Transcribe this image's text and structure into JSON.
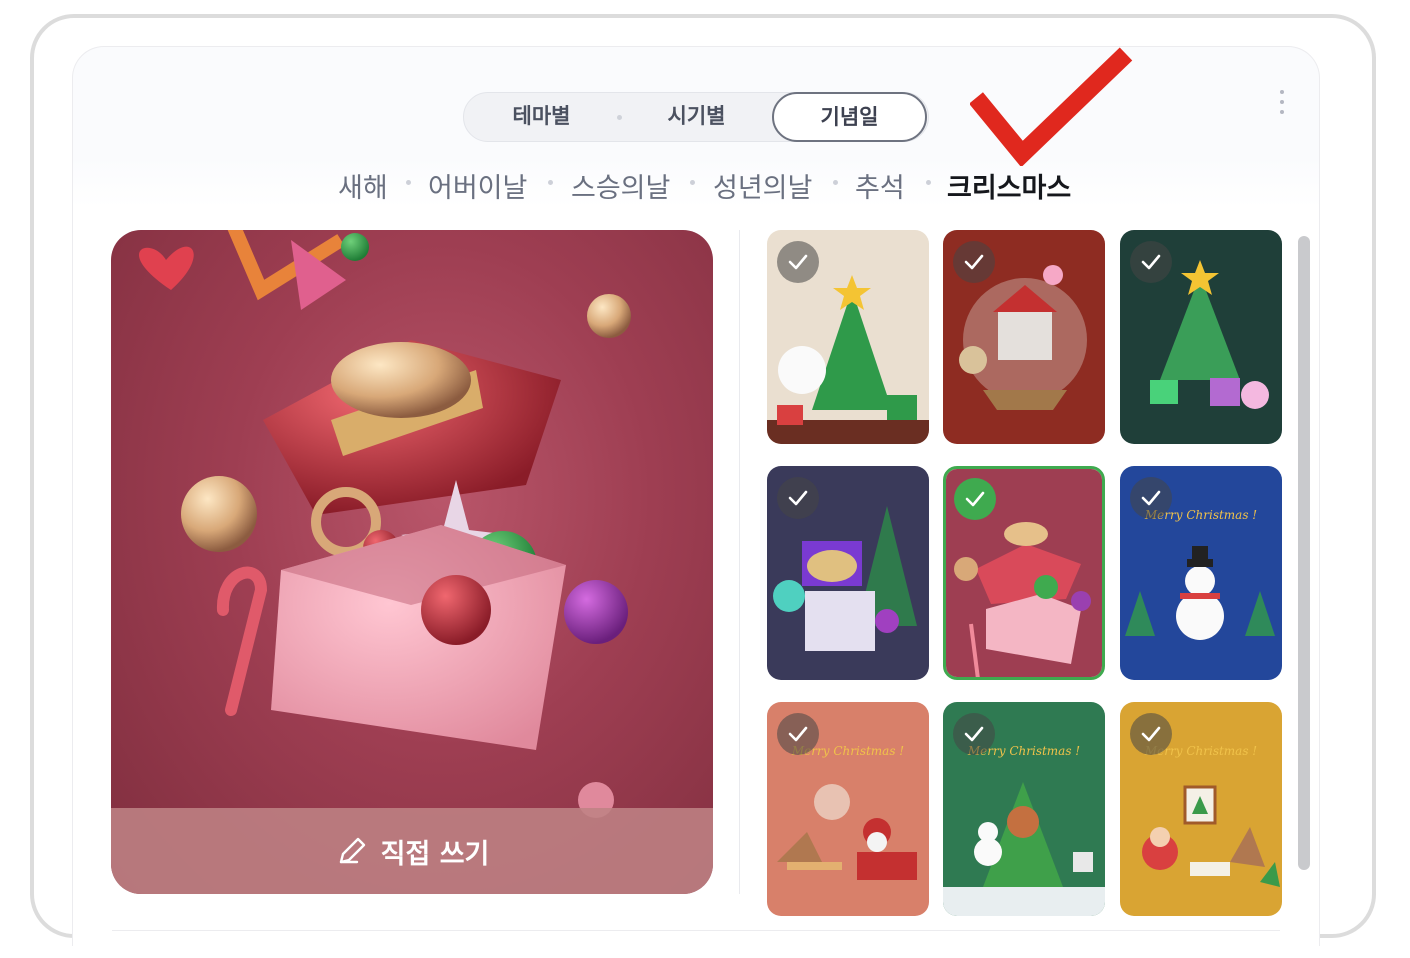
{
  "tabs": {
    "items": [
      {
        "label": "테마별"
      },
      {
        "label": "시기별"
      },
      {
        "label": "기념일"
      }
    ],
    "active": "기념일"
  },
  "categories": {
    "items": [
      {
        "label": "새해"
      },
      {
        "label": "어버이날"
      },
      {
        "label": "스승의날"
      },
      {
        "label": "성년의날"
      },
      {
        "label": "추석"
      },
      {
        "label": "크리스마스"
      }
    ],
    "active": "크리스마스"
  },
  "preview": {
    "write_label": "직접 쓰기"
  },
  "thumbnails": {
    "items": [
      {
        "caption": ""
      },
      {
        "caption": ""
      },
      {
        "caption": ""
      },
      {
        "caption": ""
      },
      {
        "caption": ""
      },
      {
        "caption": "Merry Christmas !"
      },
      {
        "caption": "Merry Christmas !"
      },
      {
        "caption": "Merry Christmas !"
      },
      {
        "caption": "Merry Christmas !"
      }
    ],
    "selected_index": 4
  },
  "colors": {
    "accent_green": "#3faa4f",
    "annotation_red": "#e0281e",
    "text_active": "#15171c"
  },
  "icons": {
    "menu": "more-vertical-icon",
    "write": "pencil-icon",
    "check": "check-icon"
  }
}
